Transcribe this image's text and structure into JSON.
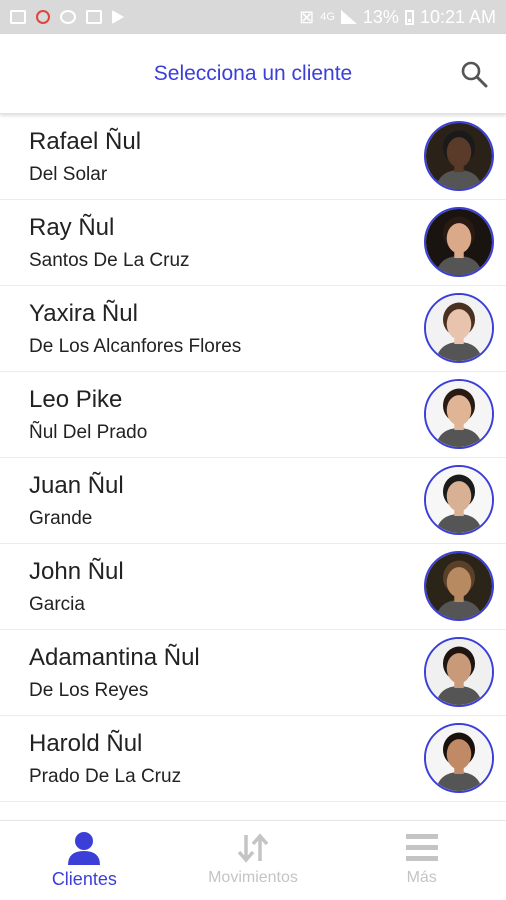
{
  "status_bar": {
    "battery_percent": "13%",
    "time": "10:21 AM",
    "network": "4G"
  },
  "header": {
    "title": "Selecciona un cliente"
  },
  "clients": [
    {
      "name": "Rafael Ñul",
      "surname": "Del Solar",
      "avatar": {
        "skin": "#5a3a28",
        "hair": "#1a1a1a",
        "bg": "#2a2118"
      }
    },
    {
      "name": "Ray Ñul",
      "surname": "Santos De La Cruz",
      "avatar": {
        "skin": "#d9a98a",
        "hair": "#2b1a12",
        "bg": "#1a1410"
      }
    },
    {
      "name": "Yaxira Ñul",
      "surname": "De Los Alcanfores Flores",
      "avatar": {
        "skin": "#e8c4ae",
        "hair": "#4a3020",
        "bg": "#f2f2f2"
      }
    },
    {
      "name": "Leo Pike",
      "surname": "Ñul Del Prado",
      "avatar": {
        "skin": "#e0b596",
        "hair": "#2a1b12",
        "bg": "#f5f5f5"
      }
    },
    {
      "name": "Juan Ñul",
      "surname": "Grande",
      "avatar": {
        "skin": "#d8b194",
        "hair": "#1a1a1a",
        "bg": "#f7f7f7"
      }
    },
    {
      "name": "John Ñul",
      "surname": "Garcia",
      "avatar": {
        "skin": "#b78a62",
        "hair": "#5a4028",
        "bg": "#2b2418"
      }
    },
    {
      "name": "Adamantina Ñul",
      "surname": "De Los Reyes",
      "avatar": {
        "skin": "#c99a7a",
        "hair": "#1f1410",
        "bg": "#f0f0f0"
      }
    },
    {
      "name": "Harold Ñul",
      "surname": "Prado De La Cruz",
      "avatar": {
        "skin": "#c08a66",
        "hair": "#1a110c",
        "bg": "#f5f5f5"
      }
    }
  ],
  "bottom_nav": [
    {
      "label": "Clientes",
      "icon": "person-icon",
      "active": true
    },
    {
      "label": "Movimientos",
      "icon": "swap-arrows-icon",
      "active": false
    },
    {
      "label": "Más",
      "icon": "menu-icon",
      "active": false
    }
  ],
  "colors": {
    "accent": "#3b3fd8",
    "inactive": "#c4c4c4",
    "status_bar": "#d9d9d9"
  }
}
